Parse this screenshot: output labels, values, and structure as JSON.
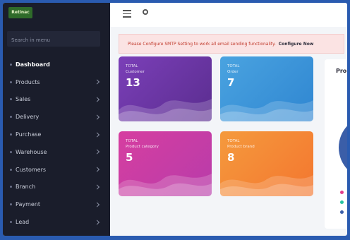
{
  "colors": {
    "sidebar_bg": "#1a1d2b",
    "card_customer": "#6b35a8",
    "card_order": "#3a95d9",
    "card_category": "#c93ea6",
    "card_brand": "#f4862f",
    "alert_text": "#c0392b"
  },
  "sidebar": {
    "brand": "Retinac",
    "search_placeholder": "Search in menu",
    "items": [
      {
        "label": "Dashboard",
        "icon": "dot-icon"
      },
      {
        "label": "Products",
        "icon": "dot-icon"
      },
      {
        "label": "Sales",
        "icon": "dot-icon"
      },
      {
        "label": "Delivery",
        "icon": "dot-icon"
      },
      {
        "label": "Purchase",
        "icon": "dot-icon"
      },
      {
        "label": "Warehouse",
        "icon": "dot-icon"
      },
      {
        "label": "Customers",
        "icon": "dot-icon"
      },
      {
        "label": "Branch",
        "icon": "dot-icon"
      },
      {
        "label": "Payment",
        "icon": "dot-icon"
      },
      {
        "label": "Lead",
        "icon": "dot-icon"
      }
    ]
  },
  "topbar": {
    "menu_icon": "hamburger-icon",
    "settings_icon": "gear-icon"
  },
  "alert": {
    "message": "Please Configure SMTP Setting to work all email sending functionality.",
    "link": "Configure Now"
  },
  "cards": [
    {
      "label_top": "TOTAL",
      "label": "Customer",
      "value": "13"
    },
    {
      "label_top": "TOTAL",
      "label": "Order",
      "value": "7"
    },
    {
      "label_top": "TOTAL",
      "label": "Product category",
      "value": "5"
    },
    {
      "label_top": "TOTAL",
      "label": "Product brand",
      "value": "8"
    }
  ],
  "panel": {
    "title": "Pro"
  }
}
